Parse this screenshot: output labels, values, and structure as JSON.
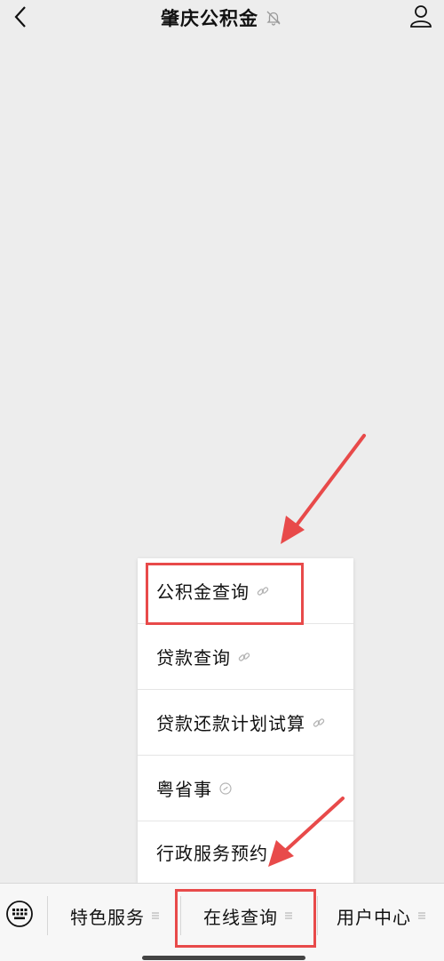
{
  "header": {
    "title": "肇庆公积金",
    "back_icon": "chevron-left-icon",
    "mute_icon": "bell-off-icon",
    "profile_icon": "person-icon"
  },
  "submenu": {
    "items": [
      {
        "label": "公积金查询",
        "icon": "link-icon"
      },
      {
        "label": "贷款查询",
        "icon": "link-icon"
      },
      {
        "label": "贷款还款计划试算",
        "icon": "link-icon"
      },
      {
        "label": "粤省事",
        "icon": "mini-program-icon"
      },
      {
        "label": "行政服务预约",
        "icon": "mini-program-icon"
      }
    ]
  },
  "bottom_menu": {
    "keyboard_icon": "keyboard-icon",
    "items": [
      {
        "label": "特色服务",
        "icon": "menu-lines-icon"
      },
      {
        "label": "在线查询",
        "icon": "menu-lines-icon"
      },
      {
        "label": "用户中心",
        "icon": "menu-lines-icon"
      }
    ]
  },
  "colors": {
    "background": "#ededed",
    "annotation_red": "#e84a4a",
    "menu_background": "#ffffff"
  }
}
